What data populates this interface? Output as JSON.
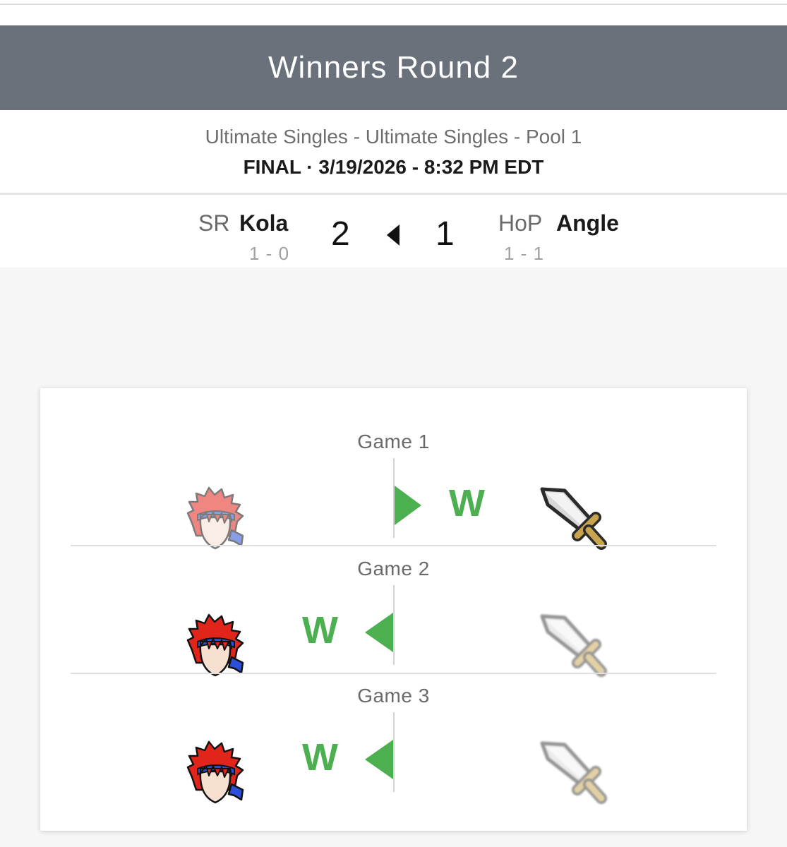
{
  "round": {
    "title": "Winners Round 2"
  },
  "event": {
    "name": "Ultimate Singles - Ultimate Singles - Pool 1",
    "status": "FINAL · 3/19/2026 - 8:32 PM EDT"
  },
  "match": {
    "player1": {
      "tag": "SR",
      "name": "Kola",
      "record": "1 - 0",
      "score": "2"
    },
    "player2": {
      "tag": "HoP",
      "name": "Angle",
      "record": "1 - 1",
      "score": "1"
    },
    "winner_side": "left"
  },
  "games": [
    {
      "label": "Game 1",
      "winner_side": "right",
      "win_text": "W",
      "p1_character_icon": "roy-head-icon",
      "p2_character_icon": "sword-icon"
    },
    {
      "label": "Game 2",
      "winner_side": "left",
      "win_text": "W",
      "p1_character_icon": "roy-head-icon",
      "p2_character_icon": "sword-icon"
    },
    {
      "label": "Game 3",
      "winner_side": "left",
      "win_text": "W",
      "p1_character_icon": "roy-head-icon",
      "p2_character_icon": "sword-icon"
    }
  ],
  "colors": {
    "header_bg": "#6b717b",
    "win_green": "#4caf50",
    "page_bg": "#f6f6f6"
  }
}
